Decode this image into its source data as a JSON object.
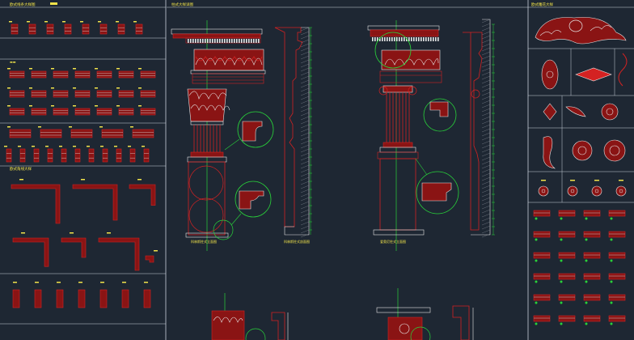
{
  "colors": {
    "background": "#1e2733",
    "frame_line": "#c9d1dc",
    "molding_red": "#d42222",
    "dark_red": "#8a1414",
    "outline_white": "#e6e6e6",
    "green_callout": "#29d33a",
    "label_yellow": "#f0e24a",
    "axis_cyan": "#30c8c8"
  },
  "panels": {
    "left": {
      "header": "欧式线条大样图",
      "cornice_section_header": "欧式角线大样"
    },
    "center": {
      "header": "柱式大样详图"
    },
    "right": {
      "header": "欧式雕花大样"
    }
  },
  "column_captions": {
    "corinthian_elevation": "科林斯柱式立面图",
    "corinthian_section": "科林斯柱式剖面图",
    "ionic_elevation": "爱奥尼柱式立面图"
  }
}
